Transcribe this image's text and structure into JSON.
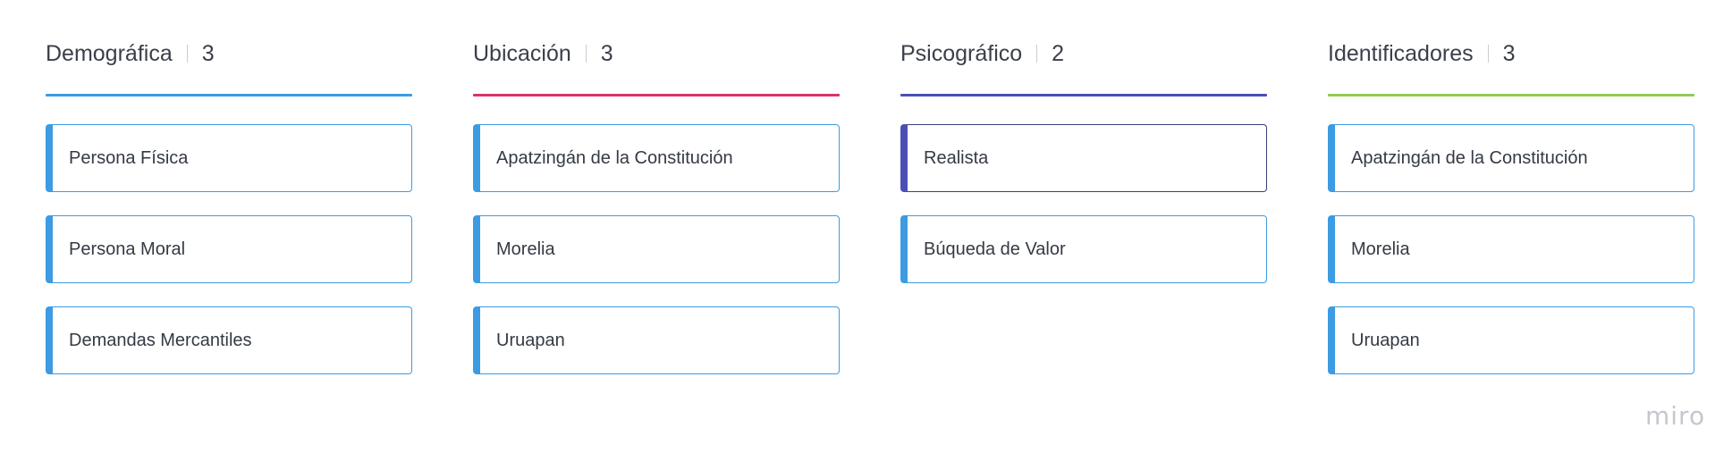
{
  "columns": [
    {
      "title": "Demográfica",
      "count": "3",
      "color": "#3c9be2",
      "cards": [
        {
          "label": "Persona Física"
        },
        {
          "label": "Persona Moral"
        },
        {
          "label": "Demandas Mercantiles"
        }
      ]
    },
    {
      "title": "Ubicación",
      "count": "3",
      "color": "#d8336d",
      "cards": [
        {
          "label": "Apatzingán de la Constitución"
        },
        {
          "label": "Morelia"
        },
        {
          "label": "Uruapan"
        }
      ]
    },
    {
      "title": "Psicográfico",
      "count": "2",
      "color": "#4b4fb5",
      "cards": [
        {
          "label": "Realista",
          "selected": true
        },
        {
          "label": "Búqueda de Valor"
        }
      ]
    },
    {
      "title": "Identificadores",
      "count": "3",
      "color": "#8fcc55",
      "cards": [
        {
          "label": "Apatzingán de la Constitución"
        },
        {
          "label": "Morelia"
        },
        {
          "label": "Uruapan"
        }
      ]
    }
  ],
  "brand": {
    "logo_text": "miro"
  }
}
